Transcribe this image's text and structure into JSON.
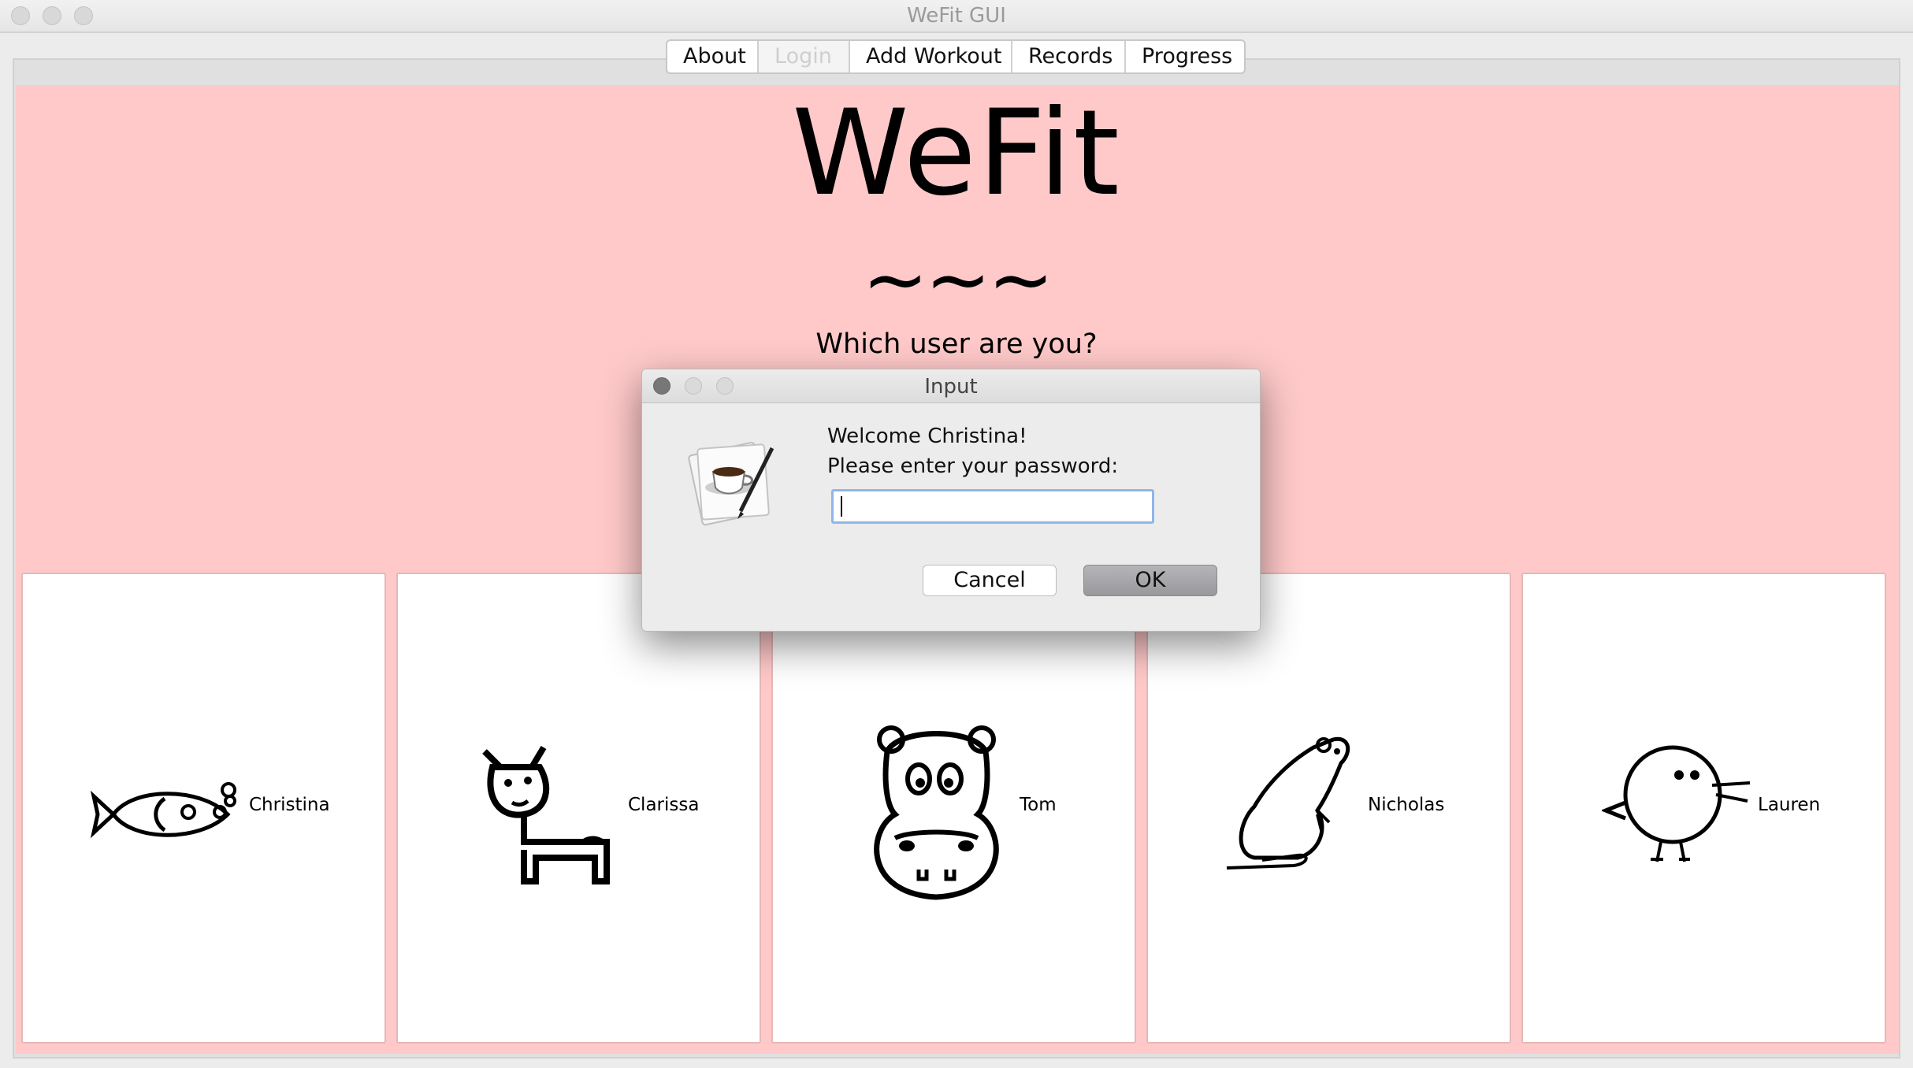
{
  "window": {
    "title": "WeFit GUI"
  },
  "tabs": [
    {
      "label": "About",
      "enabled": true
    },
    {
      "label": "Login",
      "enabled": false
    },
    {
      "label": "Add Workout",
      "enabled": true
    },
    {
      "label": "Records",
      "enabled": true
    },
    {
      "label": "Progress",
      "enabled": true
    }
  ],
  "header": {
    "brand": "WeFit",
    "divider": "~~~",
    "prompt": "Which user are you?"
  },
  "users": [
    {
      "name": "Christina",
      "icon": "fish-icon"
    },
    {
      "name": "Clarissa",
      "icon": "giraffe-icon"
    },
    {
      "name": "Tom",
      "icon": "hippo-icon"
    },
    {
      "name": "Nicholas",
      "icon": "rat-icon"
    },
    {
      "name": "Lauren",
      "icon": "bird-icon"
    }
  ],
  "dialog": {
    "title": "Input",
    "message_line1": "Welcome Christina!",
    "message_line2": "Please enter your password:",
    "password_value": "",
    "cancel_label": "Cancel",
    "ok_label": "OK",
    "icon": "java-coffee-icon"
  },
  "colors": {
    "background_pink": "#ffc9c9",
    "focus_ring": "#8fb6ea"
  }
}
